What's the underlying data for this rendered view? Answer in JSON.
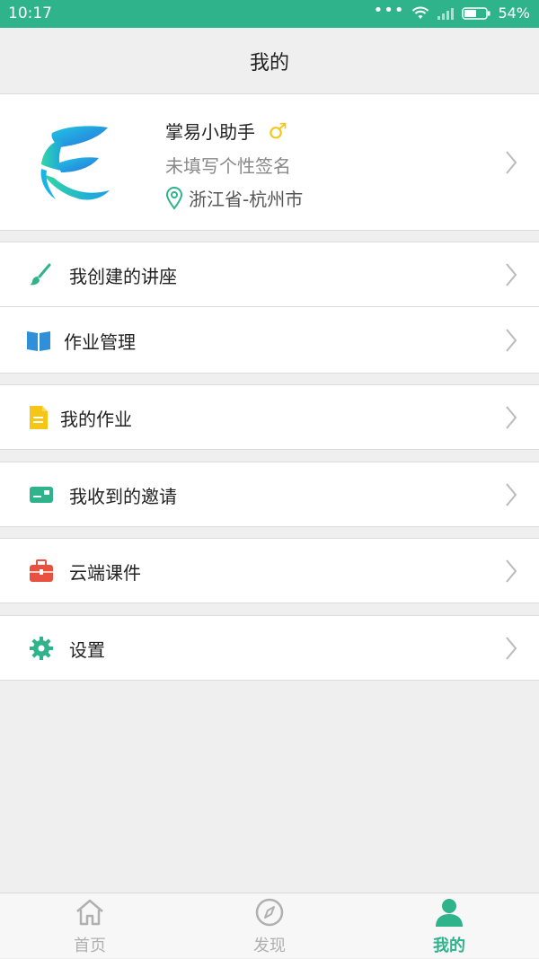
{
  "status_bar": {
    "time": "10:17",
    "battery": "54%"
  },
  "header": {
    "title": "我的"
  },
  "profile": {
    "name": "掌易小助手",
    "signature": "未填写个性签名",
    "location": "浙江省-杭州市"
  },
  "menu": [
    {
      "label": "我创建的讲座",
      "icon": "paintbrush-icon",
      "color": "#2fb38a"
    },
    {
      "label": "作业管理",
      "icon": "open-book-icon",
      "color": "#2f8fd8"
    },
    {
      "label": "我的作业",
      "icon": "document-icon",
      "color": "#f5c518"
    },
    {
      "label": "我收到的邀请",
      "icon": "id-card-icon",
      "color": "#2fb38a"
    },
    {
      "label": "云端课件",
      "icon": "briefcase-icon",
      "color": "#e8513f"
    },
    {
      "label": "设置",
      "icon": "gear-icon",
      "color": "#2fb38a"
    }
  ],
  "tabs": [
    {
      "label": "首页",
      "icon": "home-icon",
      "active": false
    },
    {
      "label": "发现",
      "icon": "compass-icon",
      "active": false
    },
    {
      "label": "我的",
      "icon": "person-icon",
      "active": true
    }
  ],
  "colors": {
    "accent": "#2fb38a",
    "inactive": "#b0b0b0",
    "male": "#f5c518"
  }
}
